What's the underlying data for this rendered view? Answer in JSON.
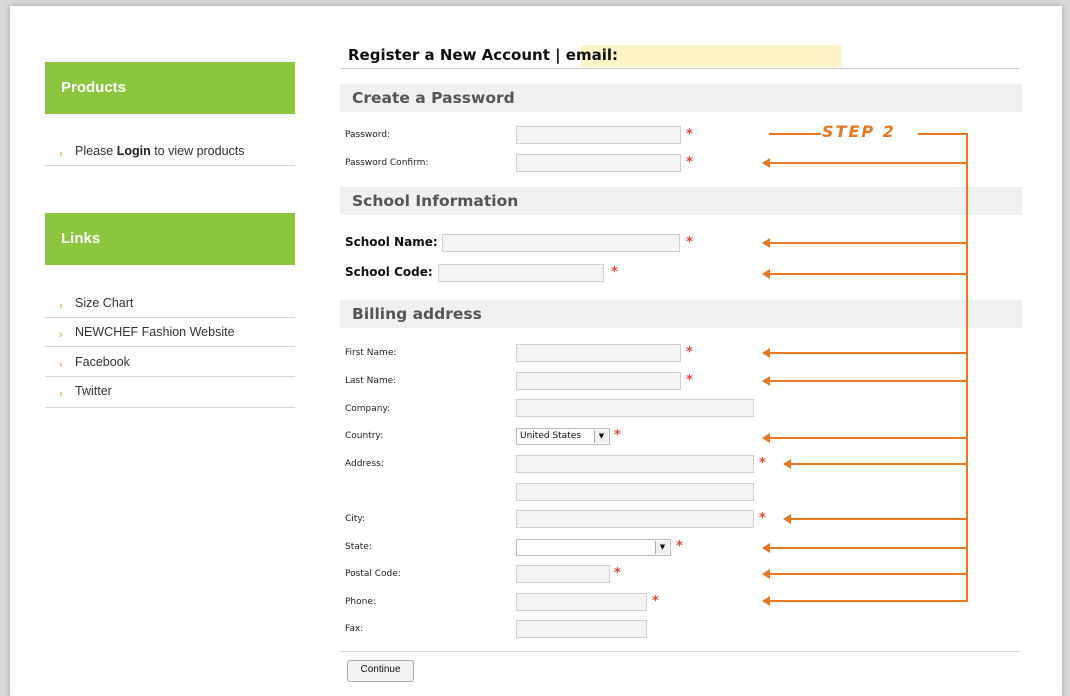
{
  "sidebar": {
    "products_title": "Products",
    "products_item_pre": "Please ",
    "products_item_login": "Login",
    "products_item_post": " to view products",
    "links_title": "Links",
    "links": [
      "Size Chart",
      "NEWCHEF Fashion Website",
      "Facebook",
      "Twitter"
    ],
    "bullet": "›"
  },
  "form": {
    "title": "Register a New Account | email:",
    "section_password": "Create a Password",
    "password_label": "Password:",
    "password_confirm_label": "Password Confirm:",
    "section_school": "School Information",
    "school_name_label": "School Name:",
    "school_code_label": "School Code:",
    "section_billing": "Billing address",
    "first_name_label": "First Name:",
    "last_name_label": "Last Name:",
    "company_label": "Company:",
    "country_label": "Country:",
    "country_value": "United States",
    "address_label": "Address:",
    "city_label": "City:",
    "state_label": "State:",
    "state_value": "",
    "postal_label": "Postal Code:",
    "phone_label": "Phone:",
    "fax_label": "Fax:",
    "required_mark": "*",
    "continue_label": "Continue"
  },
  "annotation": {
    "step_label": "STEP 2",
    "color": "#e87722"
  },
  "colors": {
    "sidebar_accent": "#8cc63f",
    "required": "#e8463b",
    "email_highlight": "#fdf3c5"
  },
  "icons": [
    "chevron-down-icon",
    "bullet-icon",
    "arrow-left-icon"
  ]
}
